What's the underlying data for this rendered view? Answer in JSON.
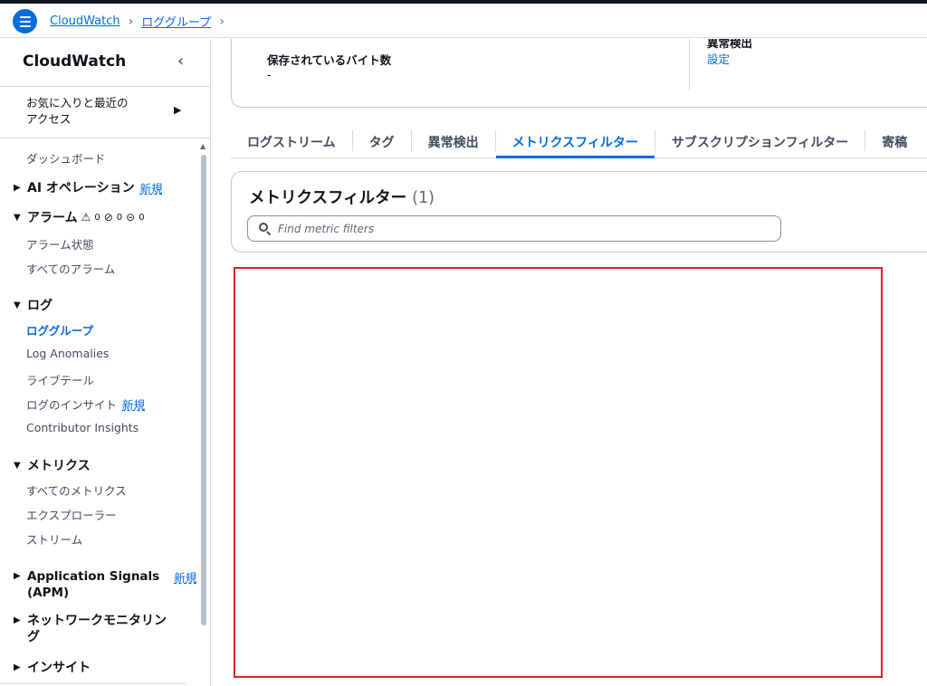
{
  "breadcrumb": {
    "items": [
      "CloudWatch",
      "ロググループ"
    ],
    "separator": "›"
  },
  "sidebar": {
    "title": "CloudWatch",
    "collapse_glyph": "‹",
    "favorites": "お気に入りと最近の\nアクセス",
    "favorites_arrow": "▶",
    "dashboard": "ダッシュボード",
    "ai_ops": "AI オペレーション",
    "new_label": "新規",
    "alarms": {
      "label": "アラーム",
      "counts": [
        "0",
        "0",
        "0"
      ],
      "items": [
        "アラーム状態",
        "すべてのアラーム"
      ]
    },
    "logs": {
      "label": "ログ",
      "items": [
        "ロググループ",
        "Log Anomalies",
        "ライブテール",
        "ログのインサイト",
        "Contributor Insights"
      ],
      "active_index": 0
    },
    "metrics": {
      "label": "メトリクス",
      "items": [
        "すべてのメトリクス",
        "エクスプローラー",
        "ストリーム"
      ]
    },
    "app_signals": "Application Signals\n(APM)",
    "network": "ネットワークモニタリン\nグ",
    "insights": "インサイト",
    "tri_closed": "▶",
    "tri_open": "▼"
  },
  "summary": {
    "stored_bytes_label": "保存されているバイト数",
    "stored_bytes_value": "-",
    "anomaly_label": "異常検出",
    "anomaly_link": "設定"
  },
  "tabs": {
    "items": [
      "ログストリーム",
      "タグ",
      "異常検出",
      "メトリクスフィルター",
      "サブスクリプションフィルター",
      "寄稿"
    ],
    "active_index": 3
  },
  "metric_filters": {
    "title": "メトリクスフィルター",
    "count": "(1)",
    "search_placeholder": "Find metric filters"
  },
  "colors": {
    "link_blue": "#006ce0",
    "highlight_red": "#e0202e"
  }
}
